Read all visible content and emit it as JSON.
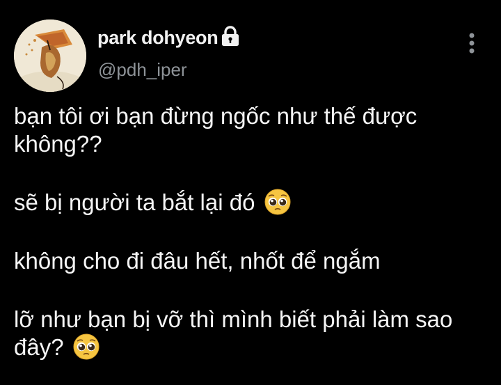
{
  "user": {
    "display_name": "park dohyeon",
    "handle": "@pdh_iper",
    "avatar_icon": "avatar-image",
    "verified_icon": "lock-icon"
  },
  "tweet": {
    "line1": "bạn tôi ơi bạn đừng ngốc như thế được",
    "line2": "không??",
    "line3": "sẽ bị người ta bắt lại đó",
    "line4": "không cho đi đâu hết, nhốt để ngắm",
    "line5": "lỡ như bạn bị vỡ thì mình biết phải làm sao",
    "line6": "đây?",
    "emoji_name": "pleading-face-emoji"
  },
  "colors": {
    "background": "#000000",
    "text": "#f1f1f1",
    "muted": "#8e9398"
  }
}
